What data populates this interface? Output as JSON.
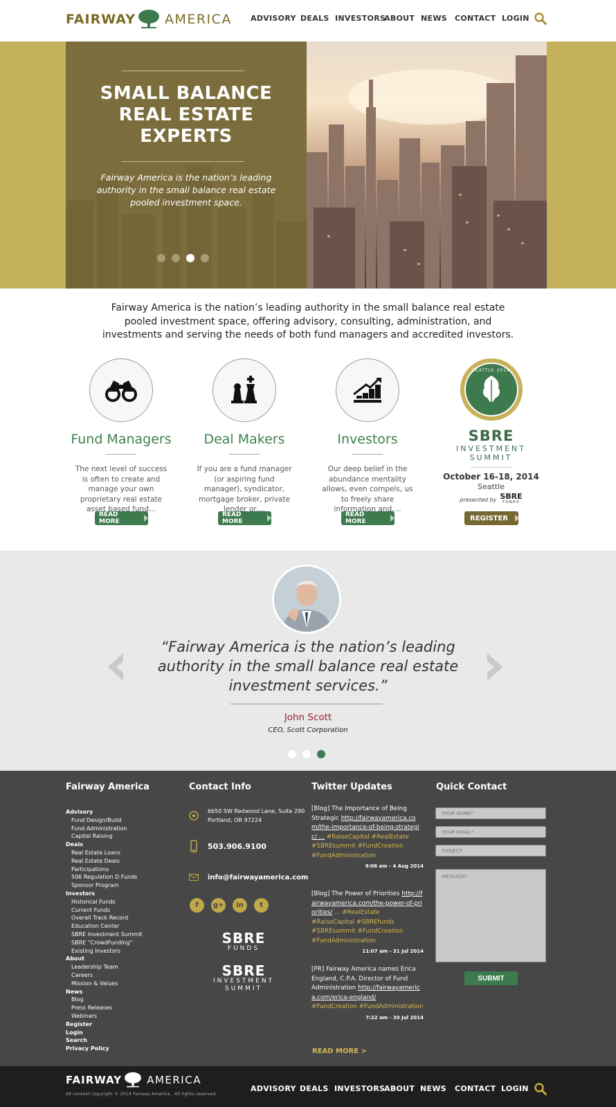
{
  "header": {
    "logo_word1": "FAIRWAY",
    "logo_word2": "AMERICA",
    "nav": [
      "ADVISORY",
      "DEALS",
      "INVESTORS",
      "ABOUT",
      "NEWS",
      "CONTACT",
      "LOGIN"
    ]
  },
  "hero": {
    "title_lines": [
      "SMALL BALANCE",
      "REAL ESTATE",
      "EXPERTS"
    ],
    "subtitle": "Fairway America is the nation’s leading authority in the small balance real estate pooled investment space.",
    "active_slide": 3,
    "slide_count": 4
  },
  "intro": "Fairway America is the nation’s leading authority in the small balance real estate pooled investment space, offering advisory, consulting, administration, and investments and serving the needs of both fund managers and accredited investors.",
  "features": [
    {
      "title": "Fund Managers",
      "desc": "The next level of success is often to create and manage your own proprietary real estate asset based fund...",
      "button": "READ MORE",
      "icon": "binoculars-icon"
    },
    {
      "title": "Deal Makers",
      "desc": "If you are a fund manager (or aspiring fund manager), syndicator, mortgage broker, private lender or....",
      "button": "READ MORE",
      "icon": "chess-pieces-icon"
    },
    {
      "title": "Investors",
      "desc": "Our deep belief in the abundance mentality allows, even compels, us to freely share information and....",
      "button": "READ MORE",
      "icon": "growth-chart-icon"
    }
  ],
  "summit": {
    "badge_text": "SEATTLE 2014",
    "title": "SBRE",
    "subtitle_line1": "INVESTMENT",
    "subtitle_line2": "SUMMIT",
    "date": "October 16-18, 2014",
    "city": "Seattle",
    "presented_by": "presented by",
    "presenter": "SBRE",
    "presenter_sub": "FUNDS",
    "button": "REGISTER"
  },
  "testimonial": {
    "quote": "“Fairway America is the nation’s leading authority in the small balance real estate investment services.”",
    "name": "John Scott",
    "role": "CEO, Scott Corporation",
    "active_slide": 3,
    "slide_count": 3
  },
  "footer": {
    "col1_title": "Fairway America",
    "links": [
      {
        "t": "Advisory",
        "lvl": 1
      },
      {
        "t": "Fund Design/Build",
        "lvl": 2
      },
      {
        "t": "Fund Administration",
        "lvl": 2
      },
      {
        "t": "Capital Raising",
        "lvl": 2
      },
      {
        "t": "Deals",
        "lvl": 1
      },
      {
        "t": "Real Estate Loans",
        "lvl": 2
      },
      {
        "t": "Real Estate Deals",
        "lvl": 2
      },
      {
        "t": "Participations",
        "lvl": 2
      },
      {
        "t": "506 Regulation D Funds",
        "lvl": 2
      },
      {
        "t": "Sponsor Program",
        "lvl": 2
      },
      {
        "t": "Investors",
        "lvl": 1
      },
      {
        "t": "Historical Funds",
        "lvl": 2
      },
      {
        "t": "Current Funds",
        "lvl": 2
      },
      {
        "t": "Overall Track Record",
        "lvl": 2
      },
      {
        "t": "Education Center",
        "lvl": 2
      },
      {
        "t": "SBRE Investment Summit",
        "lvl": 2
      },
      {
        "t": "SBRE “CrowdFunding”",
        "lvl": 2
      },
      {
        "t": "Existing Investors",
        "lvl": 2
      },
      {
        "t": "About",
        "lvl": 1
      },
      {
        "t": "Leadership Team",
        "lvl": 2
      },
      {
        "t": "Careers",
        "lvl": 2
      },
      {
        "t": "Mission & Values",
        "lvl": 2
      },
      {
        "t": "News",
        "lvl": 1
      },
      {
        "t": "Blog",
        "lvl": 2
      },
      {
        "t": "Press Releases",
        "lvl": 2
      },
      {
        "t": "Webinars",
        "lvl": 2
      },
      {
        "t": "Register",
        "lvl": 1
      },
      {
        "t": "Login",
        "lvl": 1
      },
      {
        "t": "Search",
        "lvl": 1
      },
      {
        "t": "Privacy Policy",
        "lvl": 1
      }
    ],
    "col2_title": "Contact Info",
    "address_line1": "6650 SW Redwood Lane, Suite 290",
    "address_line2": "Portland, OR 97224",
    "phone": "503.906.9100",
    "email": "info@fairwayamerica.com",
    "social": [
      "f",
      "g+",
      "in",
      "t"
    ],
    "brand1_title": "SBRE",
    "brand1_sub": "FUNDS",
    "brand2_title": "SBRE",
    "brand2_sub1": "INVESTMENT",
    "brand2_sub2": "SUMMIT",
    "col3_title": "Twitter Updates",
    "tweets": [
      {
        "text": "[Blog] The Importance of Being Strategic",
        "link": "http://fairwayamerica.com/the-importance-of-being-strategic/ ...",
        "tags": "#RaiseCapital #RealEstate #SBREsummit #FundCreation #FundAdministration",
        "time": "9:06 am - 4 Aug 2014"
      },
      {
        "text": "[Blog] The Power of Priorities",
        "link": "http://fairwayamerica.com/the-power-of-priorities/",
        "tags": "... #RealEstate #RaiseCapital #SBREfunds #SBREsummit #FundCreation #FundAdministration",
        "time": "11:07 am - 31 Jul 2014"
      },
      {
        "text": "[PR] Fairway America names Erica England, C.P.A. Director of Fund Administration",
        "link": "http://fairwayamerica.com/erica-england/",
        "tags": "#FundCreation #FundAdministration",
        "time": "7:22  am - 30 Jul 2014"
      }
    ],
    "read_more": "READ MORE >",
    "col4_title": "Quick Contact",
    "placeholders": {
      "name": "YOUR NAME*",
      "email": "YOUR EMAIL*",
      "subject": "SUBJECT",
      "message": "MESSAGE*"
    },
    "submit": "SUBMIT"
  },
  "bottom": {
    "logo_word1": "FAIRWAY",
    "logo_word2": "AMERICA",
    "copyright": "All content copyright © 2014 Fairway America . All rights reserved"
  },
  "colors": {
    "green": "#3d7a4e",
    "gold": "#c5b15b",
    "olive": "#7c6d3d",
    "footer": "#474747",
    "quote_name": "#9b1d2a"
  }
}
